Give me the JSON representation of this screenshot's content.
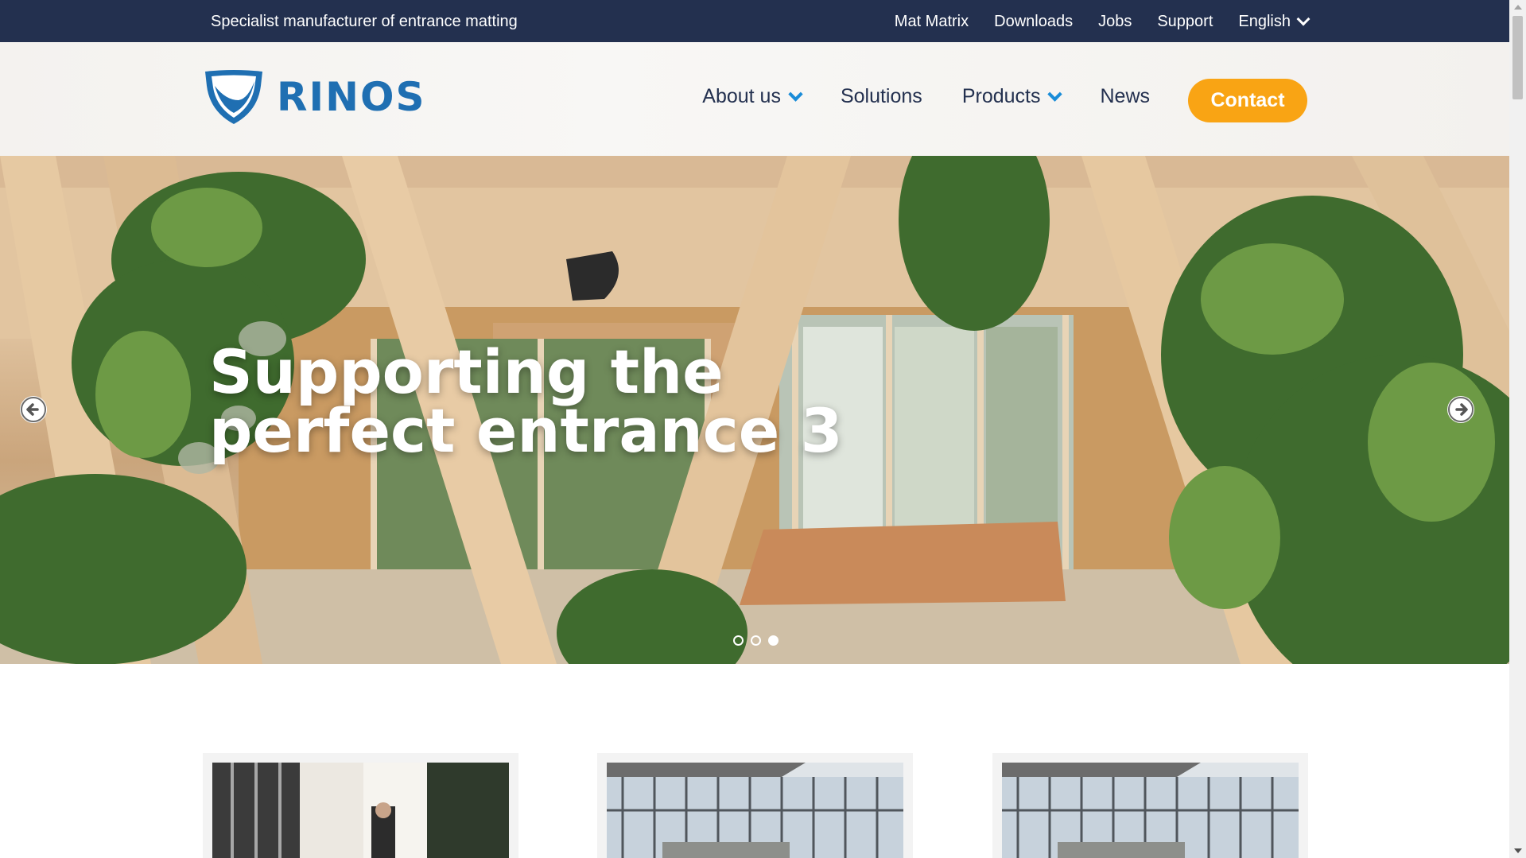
{
  "topbar": {
    "tagline": "Specialist manufacturer of entrance matting",
    "links": [
      "Mat Matrix",
      "Downloads",
      "Jobs",
      "Support"
    ],
    "language": "English"
  },
  "header": {
    "logo_text": "RINOS",
    "nav": {
      "about": "About us",
      "solutions": "Solutions",
      "products": "Products",
      "news": "News"
    },
    "contact_label": "Contact"
  },
  "hero": {
    "title": "Supporting the perfect entrance 3",
    "slides_total": 3,
    "active_slide": 3
  },
  "colors": {
    "topbar": "#23304f",
    "brand_blue": "#1f6fb2",
    "accent_orange": "#f9a414",
    "nav_text": "#23304f"
  },
  "icons": {
    "prev": "arrow-left-circle-icon",
    "next": "arrow-right-circle-icon",
    "language": "chevron-down-icon"
  }
}
